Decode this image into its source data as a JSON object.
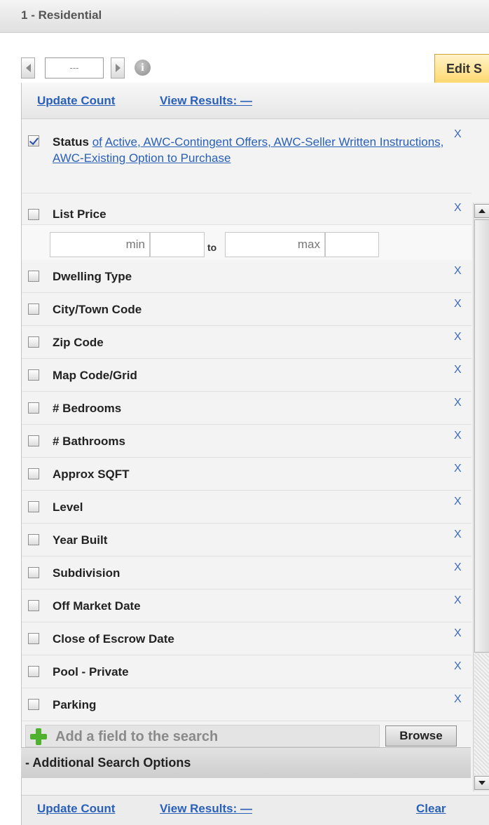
{
  "header": {
    "number": "1",
    "title": "- Residential"
  },
  "pager": {
    "value": "---"
  },
  "edit_tab": {
    "label": "Edit S"
  },
  "top_links": {
    "update_count": "Update Count",
    "view_results": "View Results: —"
  },
  "status": {
    "label": "Status",
    "of": "of",
    "values": "Active, AWC-Contingent Offers, AWC-Seller Written Instructions, AWC-Existing Option to Purchase",
    "checked": true
  },
  "list_price": {
    "label": "List Price",
    "min_placeholder": "min",
    "to": "to",
    "max_placeholder": "max"
  },
  "remove_glyph": "X",
  "fields": [
    "Dwelling Type",
    "City/Town Code",
    "Zip Code",
    "Map Code/Grid",
    "# Bedrooms",
    "# Bathrooms",
    "Approx SQFT",
    "Level",
    "Year Built",
    "Subdivision",
    "Off Market Date",
    "Close of Escrow Date",
    "Pool - Private",
    "Parking"
  ],
  "add_field": {
    "placeholder": "Add a field to the search",
    "browse_label": "Browse"
  },
  "additional_options": {
    "label": "- Additional Search Options"
  },
  "bottom_links": {
    "update_count": "Update Count",
    "view_results": "View Results: —",
    "clear": "Clear"
  }
}
